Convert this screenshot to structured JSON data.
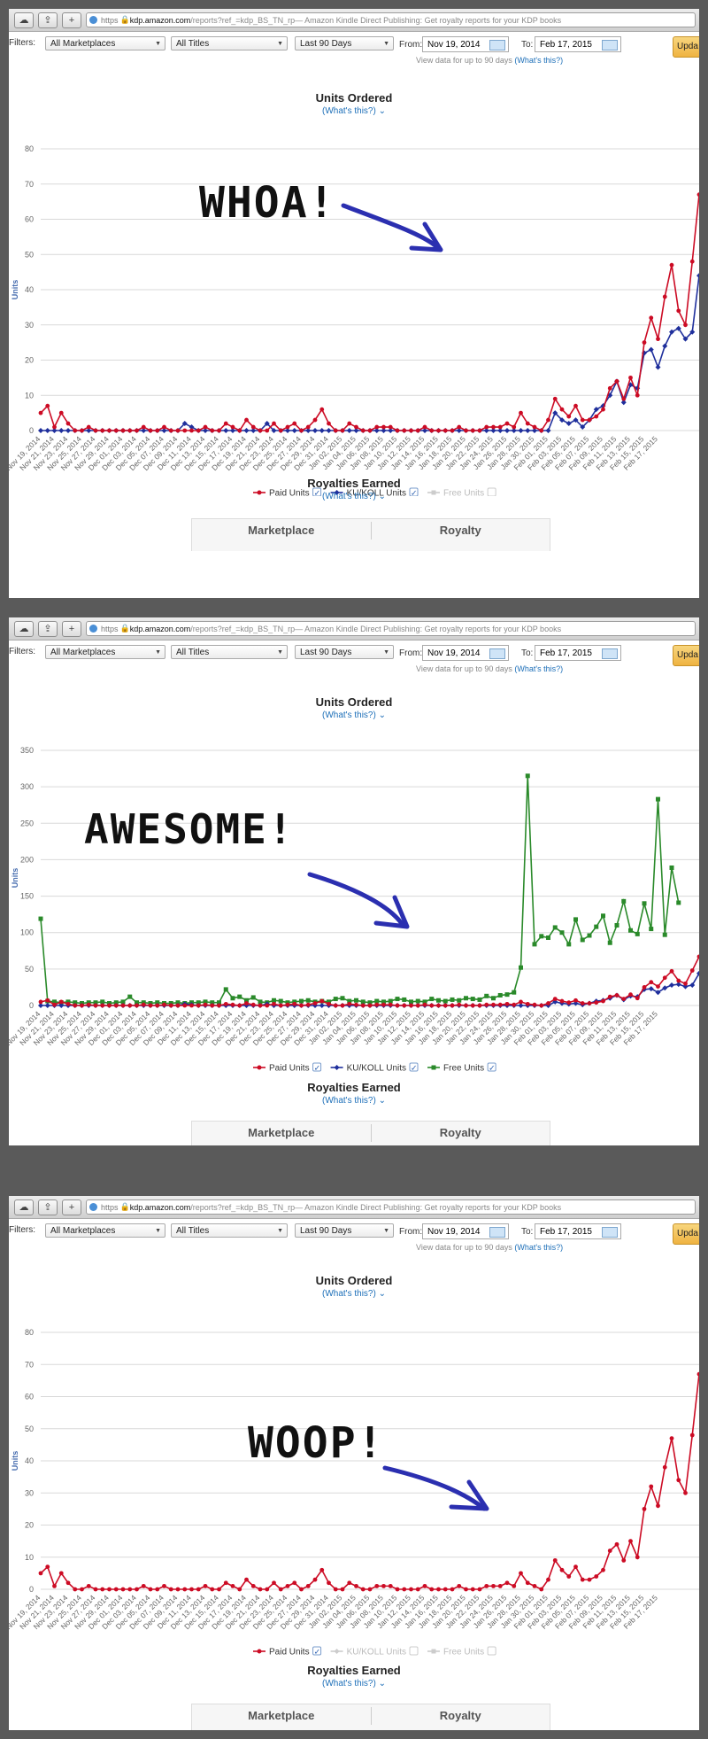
{
  "browser": {
    "https": "https",
    "domain": "kdp.amazon.com",
    "path": "/reports?ref_=kdp_BS_TN_rp",
    "title": " — Amazon Kindle Direct Publishing: Get royalty reports for your KDP books"
  },
  "filters": {
    "label": "Filters:",
    "marketplace": "All Marketplaces",
    "titles": "All Titles",
    "range": "Last 90 Days",
    "from_label": "From:",
    "from": "Nov 19, 2014",
    "to_label": "To:",
    "to": "Feb 17, 2015",
    "hint": "View data for up to 90 days",
    "hint_link": "(What's this?)",
    "update": "Upda"
  },
  "chart_title": "Units Ordered",
  "whats_this": "(What's this?)",
  "ylabel": "Units",
  "royalties": {
    "title": "Royalties Earned",
    "link": "(What's this?)",
    "col1": "Marketplace",
    "col2": "Royalty"
  },
  "legend": {
    "paid": "Paid Units",
    "ku": "KU/KOLL Units",
    "free": "Free Units"
  },
  "annotations": {
    "panel1": "WHOA!",
    "panel2": "AWESOME!",
    "panel3": "WOOP!"
  },
  "colors": {
    "paid": "#cc0b24",
    "ku": "#1f2f9c",
    "free": "#2a8a2a",
    "arrow": "#2b2fb0"
  },
  "chart_data": [
    {
      "type": "line",
      "title": "Units Ordered",
      "ylabel": "Units",
      "ylim": [
        0,
        80
      ],
      "yticks": [
        0,
        10,
        20,
        30,
        40,
        50,
        60,
        70,
        80
      ],
      "grid": true,
      "legend": "bottom",
      "series": [
        {
          "name": "Paid Units",
          "values": [
            5,
            7,
            1,
            5,
            2,
            0,
            0,
            1,
            0,
            0,
            0,
            0,
            0,
            0,
            0,
            1,
            0,
            0,
            1,
            0,
            0,
            0,
            0,
            0,
            1,
            0,
            0,
            2,
            1,
            0,
            3,
            1,
            0,
            0,
            2,
            0,
            1,
            2,
            0,
            1,
            3,
            6,
            2,
            0,
            0,
            2,
            1,
            0,
            0,
            1,
            1,
            1,
            0,
            0,
            0,
            0,
            1,
            0,
            0,
            0,
            0,
            1,
            0,
            0,
            0,
            1,
            1,
            1,
            2,
            1,
            5,
            2,
            1,
            0,
            3,
            9,
            6,
            4,
            7,
            3,
            3,
            4,
            6,
            12,
            14,
            9,
            15,
            10,
            25,
            32,
            26,
            38,
            47,
            34,
            30,
            48,
            67
          ]
        },
        {
          "name": "KU/KOLL Units",
          "values": [
            0,
            0,
            0,
            0,
            0,
            0,
            0,
            0,
            0,
            0,
            0,
            0,
            0,
            0,
            0,
            0,
            0,
            0,
            0,
            0,
            0,
            2,
            1,
            0,
            0,
            0,
            0,
            0,
            0,
            0,
            0,
            0,
            0,
            2,
            0,
            0,
            0,
            0,
            0,
            0,
            0,
            0,
            0,
            0,
            0,
            0,
            0,
            0,
            0,
            0,
            0,
            0,
            0,
            0,
            0,
            0,
            0,
            0,
            0,
            0,
            0,
            0,
            0,
            0,
            0,
            0,
            0,
            0,
            0,
            0,
            0,
            0,
            0,
            0,
            0,
            5,
            3,
            2,
            3,
            1,
            3,
            6,
            7,
            10,
            14,
            8,
            13,
            12,
            22,
            23,
            18,
            24,
            28,
            29,
            26,
            28,
            44
          ]
        }
      ]
    },
    {
      "type": "line",
      "title": "Units Ordered",
      "ylabel": "Units",
      "ylim": [
        0,
        350
      ],
      "yticks": [
        0,
        50,
        100,
        150,
        200,
        250,
        300,
        350
      ],
      "grid": true,
      "legend": "bottom",
      "series": [
        {
          "name": "Paid Units",
          "values": [
            5,
            7,
            1,
            5,
            2,
            0,
            0,
            1,
            0,
            0,
            0,
            0,
            0,
            0,
            0,
            1,
            0,
            0,
            1,
            0,
            0,
            0,
            0,
            0,
            1,
            0,
            0,
            2,
            1,
            0,
            3,
            1,
            0,
            0,
            2,
            0,
            1,
            2,
            0,
            1,
            3,
            6,
            2,
            0,
            0,
            2,
            1,
            0,
            0,
            1,
            1,
            1,
            0,
            0,
            0,
            0,
            1,
            0,
            0,
            0,
            0,
            1,
            0,
            0,
            0,
            1,
            1,
            1,
            2,
            1,
            5,
            2,
            1,
            0,
            3,
            9,
            6,
            4,
            7,
            3,
            3,
            4,
            6,
            12,
            14,
            9,
            15,
            10,
            25,
            32,
            26,
            38,
            47,
            34,
            30,
            48,
            67
          ]
        },
        {
          "name": "KU/KOLL Units",
          "values": [
            0,
            0,
            0,
            0,
            0,
            0,
            0,
            0,
            0,
            0,
            0,
            0,
            0,
            0,
            0,
            0,
            0,
            0,
            0,
            0,
            0,
            2,
            1,
            0,
            0,
            0,
            0,
            0,
            0,
            0,
            0,
            0,
            0,
            2,
            0,
            0,
            0,
            0,
            0,
            0,
            0,
            0,
            0,
            0,
            0,
            0,
            0,
            0,
            0,
            0,
            0,
            0,
            0,
            0,
            0,
            0,
            0,
            0,
            0,
            0,
            0,
            0,
            0,
            0,
            0,
            0,
            0,
            0,
            0,
            0,
            0,
            0,
            0,
            0,
            0,
            5,
            3,
            2,
            3,
            1,
            3,
            6,
            7,
            10,
            14,
            8,
            13,
            12,
            22,
            23,
            18,
            24,
            28,
            29,
            26,
            28,
            44
          ]
        },
        {
          "name": "Free Units",
          "values": [
            119,
            6,
            5,
            4,
            5,
            4,
            3,
            4,
            4,
            5,
            3,
            4,
            5,
            12,
            4,
            4,
            3,
            4,
            3,
            3,
            4,
            3,
            4,
            4,
            5,
            4,
            4,
            22,
            10,
            12,
            7,
            11,
            5,
            4,
            7,
            6,
            4,
            5,
            6,
            7,
            5,
            6,
            5,
            9,
            10,
            6,
            7,
            5,
            4,
            6,
            5,
            6,
            9,
            8,
            5,
            6,
            5,
            9,
            7,
            6,
            8,
            7,
            10,
            9,
            8,
            13,
            10,
            14,
            15,
            18,
            52,
            315,
            84,
            95,
            93,
            107,
            100,
            84,
            118,
            90,
            96,
            108,
            123,
            86,
            110,
            143,
            103,
            98,
            140,
            105,
            283,
            97,
            189,
            141
          ]
        }
      ]
    },
    {
      "type": "line",
      "title": "Units Ordered",
      "ylabel": "Units",
      "ylim": [
        0,
        80
      ],
      "yticks": [
        0,
        10,
        20,
        30,
        40,
        50,
        60,
        70,
        80
      ],
      "grid": true,
      "legend": "bottom",
      "series": [
        {
          "name": "Paid Units",
          "values": [
            5,
            7,
            1,
            5,
            2,
            0,
            0,
            1,
            0,
            0,
            0,
            0,
            0,
            0,
            0,
            1,
            0,
            0,
            1,
            0,
            0,
            0,
            0,
            0,
            1,
            0,
            0,
            2,
            1,
            0,
            3,
            1,
            0,
            0,
            2,
            0,
            1,
            2,
            0,
            1,
            3,
            6,
            2,
            0,
            0,
            2,
            1,
            0,
            0,
            1,
            1,
            1,
            0,
            0,
            0,
            0,
            1,
            0,
            0,
            0,
            0,
            1,
            0,
            0,
            0,
            1,
            1,
            1,
            2,
            1,
            5,
            2,
            1,
            0,
            3,
            9,
            6,
            4,
            7,
            3,
            3,
            4,
            6,
            12,
            14,
            9,
            15,
            10,
            25,
            32,
            26,
            38,
            47,
            34,
            30,
            48,
            67
          ]
        }
      ]
    }
  ],
  "xtick_labels": [
    "Nov 19, 2014",
    "Nov 21, 2014",
    "Nov 23, 2014",
    "Nov 25, 2014",
    "Nov 27, 2014",
    "Nov 29, 2014",
    "Dec 01, 2014",
    "Dec 03, 2014",
    "Dec 05, 2014",
    "Dec 07, 2014",
    "Dec 09, 2014",
    "Dec 11, 2014",
    "Dec 13, 2014",
    "Dec 15, 2014",
    "Dec 17, 2014",
    "Dec 19, 2014",
    "Dec 21, 2014",
    "Dec 23, 2014",
    "Dec 25, 2014",
    "Dec 27, 2014",
    "Dec 29, 2014",
    "Dec 31, 2014",
    "Jan 02, 2015",
    "Jan 04, 2015",
    "Jan 06, 2015",
    "Jan 08, 2015",
    "Jan 10, 2015",
    "Jan 12, 2015",
    "Jan 14, 2015",
    "Jan 16, 2015",
    "Jan 18, 2015",
    "Jan 20, 2015",
    "Jan 22, 2015",
    "Jan 24, 2015",
    "Jan 26, 2015",
    "Jan 28, 2015",
    "Jan 30, 2015",
    "Feb 01, 2015",
    "Feb 03, 2015",
    "Feb 05, 2015",
    "Feb 07, 2015",
    "Feb 09, 2015",
    "Feb 11, 2015",
    "Feb 13, 2015",
    "Feb 15, 2015",
    "Feb 17, 2015"
  ]
}
